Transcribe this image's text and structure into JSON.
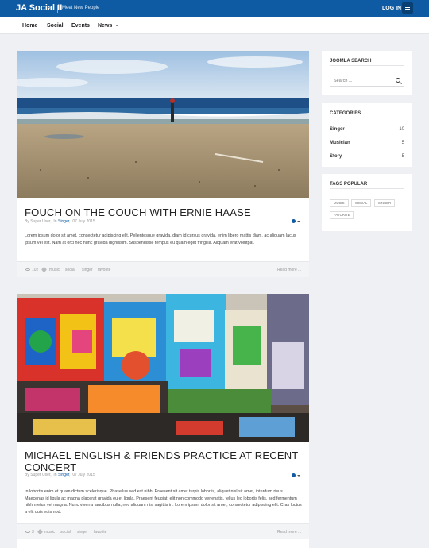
{
  "topbar": {
    "brand": "JA Social II",
    "tagline": "Meet New People",
    "login": "LOG IN"
  },
  "nav": {
    "items": [
      "Home",
      "Social",
      "Events",
      "News"
    ]
  },
  "colors": {
    "brand": "#0f5ba3",
    "accent": "#0f5ba3"
  },
  "posts": [
    {
      "title": "FOUCH ON THE COUCH WITH ERNIE HAASE",
      "author": "By Super User",
      "in_label": "In",
      "category": "Singer",
      "date": "07 July 2015",
      "excerpt": "Lorem ipsum dolor sit amet, consectetur adipiscing elit. Pellentesque gravida, diam id cursus gravida, enim libero mattis diam, ac aliquam lacus ipsum vel est. Nam at orci nec nunc gravida dignissim. Suspendisse tempus eu quam eget fringilla. Aliquam erat volutpat.",
      "views": "102",
      "tags": [
        "music",
        "social",
        "singer",
        "favorite"
      ],
      "read_more": "Read more ..."
    },
    {
      "title": "MICHAEL ENGLISH & FRIENDS PRACTICE AT RECENT CONCERT",
      "author": "By Super User",
      "in_label": "In",
      "category": "Singer",
      "date": "07 July 2015",
      "excerpt": "In lobortis enim et quam dictum scelerisque. Phasellus sed est nibh. Praesent sit amet turpis lobortis, aliquet nisl sit amet, interdum risus. Maecenas id ligula ac magna placerat gravida eu et ligula. Praesent feugiat, elit non commodo venenatis, tellus leo lobortis felis, sed fermentum nibh metus vel magna. Nunc viverra faucibus nulla, nec aliquam nisl sagittis in. Lorem ipsum dolor sit amet, consectetur adipiscing elit. Cras luctus a elit quis euismod.",
      "views": "3",
      "tags": [
        "music",
        "social",
        "singer",
        "favorite"
      ],
      "read_more": "Read more ..."
    }
  ],
  "sidebar": {
    "search": {
      "title": "JOOMLA SEARCH",
      "placeholder": "Search ..."
    },
    "categories": {
      "title": "CATEGORIES",
      "items": [
        {
          "name": "Singer",
          "count": "10"
        },
        {
          "name": "Musician",
          "count": "5"
        },
        {
          "name": "Story",
          "count": "5"
        }
      ]
    },
    "tags": {
      "title": "TAGS POPULAR",
      "items": [
        "MUSIC",
        "SOCIAL",
        "SINGER",
        "FAVORITE"
      ]
    }
  }
}
